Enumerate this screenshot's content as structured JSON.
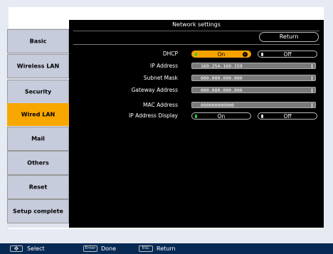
{
  "title": "Network settings",
  "return_label": "Return",
  "sidebar": {
    "items": [
      {
        "label": "Basic"
      },
      {
        "label": "Wireless LAN"
      },
      {
        "label": "Security"
      },
      {
        "label": "Wired LAN"
      },
      {
        "label": "Mail"
      },
      {
        "label": "Others"
      },
      {
        "label": "Reset"
      },
      {
        "label": "Setup complete"
      }
    ],
    "active": "Wired LAN"
  },
  "settings": {
    "dhcp": {
      "label": "DHCP",
      "on": "On",
      "off": "Off",
      "selected": "On"
    },
    "ip_address": {
      "label": "IP Address",
      "value": "169.254.169.159"
    },
    "subnet_mask": {
      "label": "Subnet Mask",
      "value": "000.000.000.000"
    },
    "gateway_address": {
      "label": "Gateway Address",
      "value": "000.000.000.000"
    },
    "mac_address": {
      "label": "MAC Address",
      "value": "090000000900"
    },
    "ip_display": {
      "label": "IP Address Display",
      "on": "On",
      "off": "Off"
    }
  },
  "footer": {
    "select_label": "Select",
    "enter_key": "Enter",
    "done_label": "Done",
    "esc_key": "ESC",
    "return_label": "Return"
  },
  "colors": {
    "accent": "#f8a700",
    "panel": "#000000",
    "footer": "#072a55"
  }
}
